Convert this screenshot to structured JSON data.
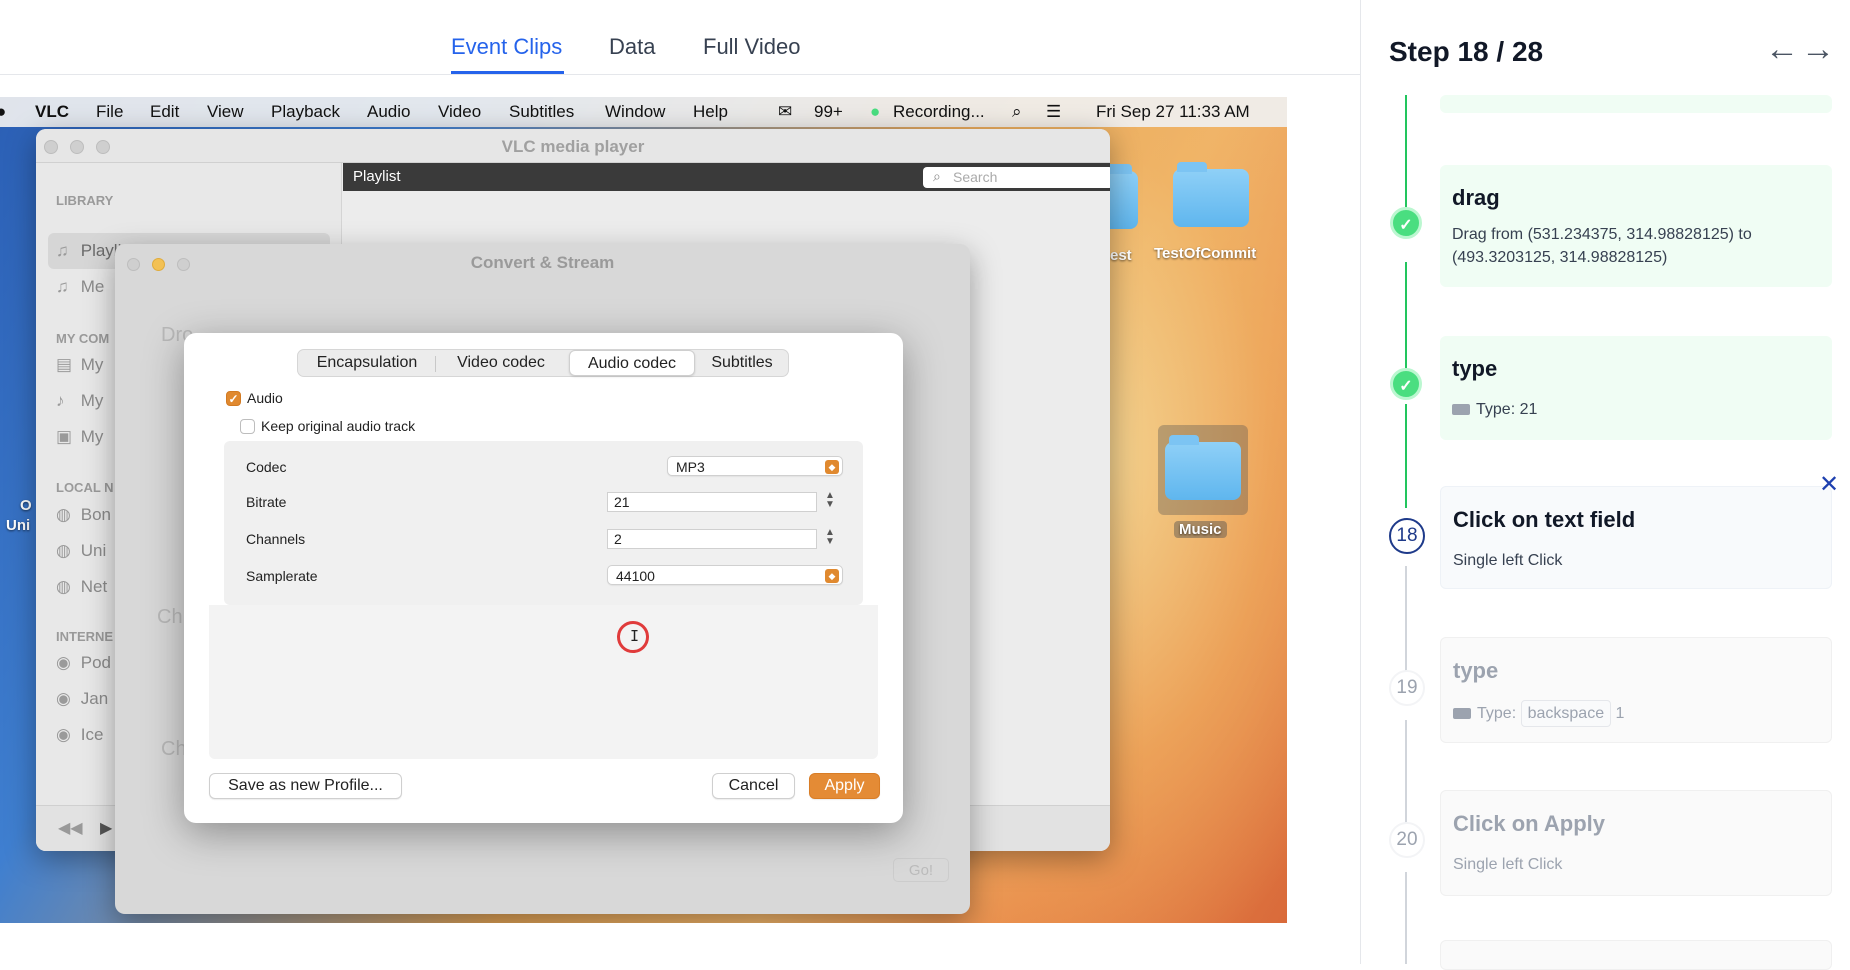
{
  "tabs": {
    "event_clips": "Event Clips",
    "data": "Data",
    "full_video": "Full Video"
  },
  "menubar": {
    "apple": "",
    "app": "VLC",
    "file": "File",
    "edit": "Edit",
    "view": "View",
    "playback": "Playback",
    "audio": "Audio",
    "video": "Video",
    "subtitles": "Subtitles",
    "window": "Window",
    "help": "Help",
    "notif": "99+",
    "recording": "Recording...",
    "datetime": "Fri Sep 27  11:33 AM"
  },
  "vlc": {
    "title": "VLC media player",
    "playlist_bar": "Playlist",
    "search_placeholder": "Search",
    "sidebar": {
      "library": "LIBRARY",
      "playlist": "Playlist",
      "media": "Me",
      "my_computer": "MY COM",
      "my1": "My",
      "my2": "My",
      "my3": "My",
      "local": "LOCAL N",
      "bon": "Bon",
      "uni": "Uni",
      "net": "Net",
      "internet": "INTERNE",
      "pod": "Pod",
      "jam": "Jan",
      "ice": "Ice"
    }
  },
  "desktop": {
    "test_label": "est",
    "commit_label": "TestOfCommit",
    "music_label": "Music",
    "left_label_1": "O",
    "left_label_2": "Uni"
  },
  "convert": {
    "title": "Convert & Stream",
    "ghost_drop": "Dro",
    "ghost_ch1": "Ch",
    "ghost_ch2": "Ch",
    "go": "Go!"
  },
  "sheet": {
    "tabs": {
      "encapsulation": "Encapsulation",
      "video_codec": "Video codec",
      "audio_codec": "Audio codec",
      "subtitles": "Subtitles"
    },
    "audio_label": "Audio",
    "audio_checkmark": "✓",
    "keep_original": "Keep original audio track",
    "codec_label": "Codec",
    "codec_value": "MP3",
    "bitrate_label": "Bitrate",
    "bitrate_value": "21",
    "channels_label": "Channels",
    "channels_value": "2",
    "samplerate_label": "Samplerate",
    "samplerate_value": "44100",
    "save_profile": "Save as new Profile...",
    "cancel": "Cancel",
    "apply": "Apply"
  },
  "steps": {
    "header": "Step 18 / 28",
    "items": [
      {
        "title": "drag",
        "desc": "Drag from (531.234375, 314.98828125) to (493.3203125, 314.98828125)"
      },
      {
        "title": "type",
        "desc": "Type: 21"
      },
      {
        "number": "18",
        "title": "Click on text field",
        "desc": "Single left Click"
      },
      {
        "number": "19",
        "title": "type",
        "desc_prefix": "Type:",
        "chip": "backspace",
        "suffix": "1"
      },
      {
        "number": "20",
        "title": "Click on Apply",
        "desc": "Single left Click"
      }
    ]
  },
  "colors": {
    "accent": "#2563eb",
    "done": "#22c55e",
    "vlc_orange": "#e48b35",
    "click_ring": "#e03b3b"
  }
}
